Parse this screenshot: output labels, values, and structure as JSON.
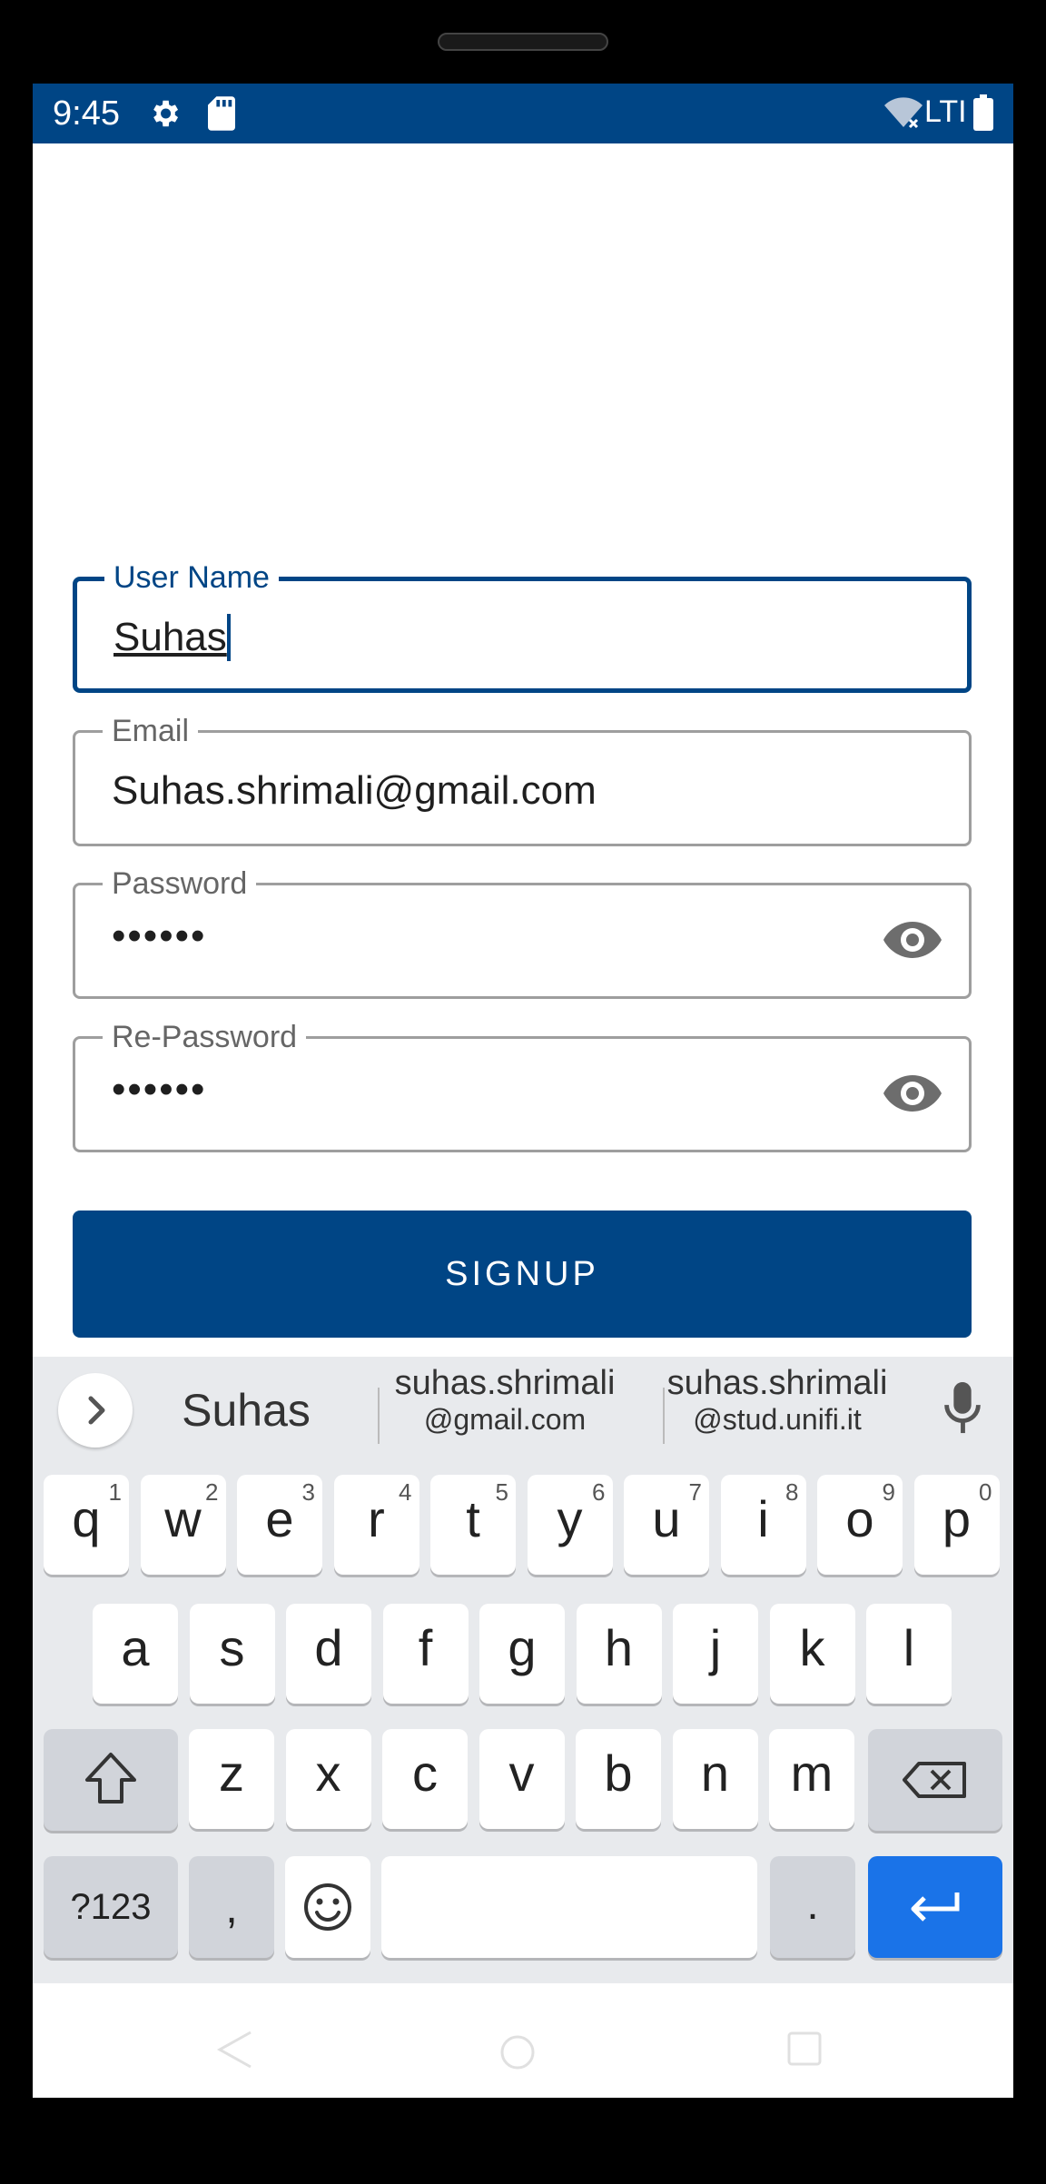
{
  "status_bar": {
    "time": "9:45",
    "network": "LTI",
    "icons": [
      "gear-icon",
      "sd-card-icon",
      "wifi-off-icon",
      "battery-icon"
    ]
  },
  "form": {
    "username": {
      "label": "User Name",
      "value": "Suhas"
    },
    "email": {
      "label": "Email",
      "value": "Suhas.shrimali@gmail.com"
    },
    "password": {
      "label": "Password",
      "value": "••••••"
    },
    "repassword": {
      "label": "Re-Password",
      "value": "••••••"
    },
    "signup_label": "SIGNUP"
  },
  "keyboard": {
    "suggestions": {
      "first": "Suhas",
      "second_top": "suhas.shrimali",
      "second_bottom": "@gmail.com",
      "third_top": "suhas.shrimali",
      "third_bottom": "@stud.unifi.it"
    },
    "row1": [
      {
        "char": "q",
        "hint": "1"
      },
      {
        "char": "w",
        "hint": "2"
      },
      {
        "char": "e",
        "hint": "3"
      },
      {
        "char": "r",
        "hint": "4"
      },
      {
        "char": "t",
        "hint": "5"
      },
      {
        "char": "y",
        "hint": "6"
      },
      {
        "char": "u",
        "hint": "7"
      },
      {
        "char": "i",
        "hint": "8"
      },
      {
        "char": "o",
        "hint": "9"
      },
      {
        "char": "p",
        "hint": "0"
      }
    ],
    "row2": [
      "a",
      "s",
      "d",
      "f",
      "g",
      "h",
      "j",
      "k",
      "l"
    ],
    "row3": [
      "z",
      "x",
      "c",
      "v",
      "b",
      "n",
      "m"
    ],
    "symbols_label": "?123",
    "comma": ",",
    "period": "."
  },
  "colors": {
    "primary": "#004585",
    "enter_key": "#1a73e8",
    "keyboard_bg": "#e8eaed"
  }
}
